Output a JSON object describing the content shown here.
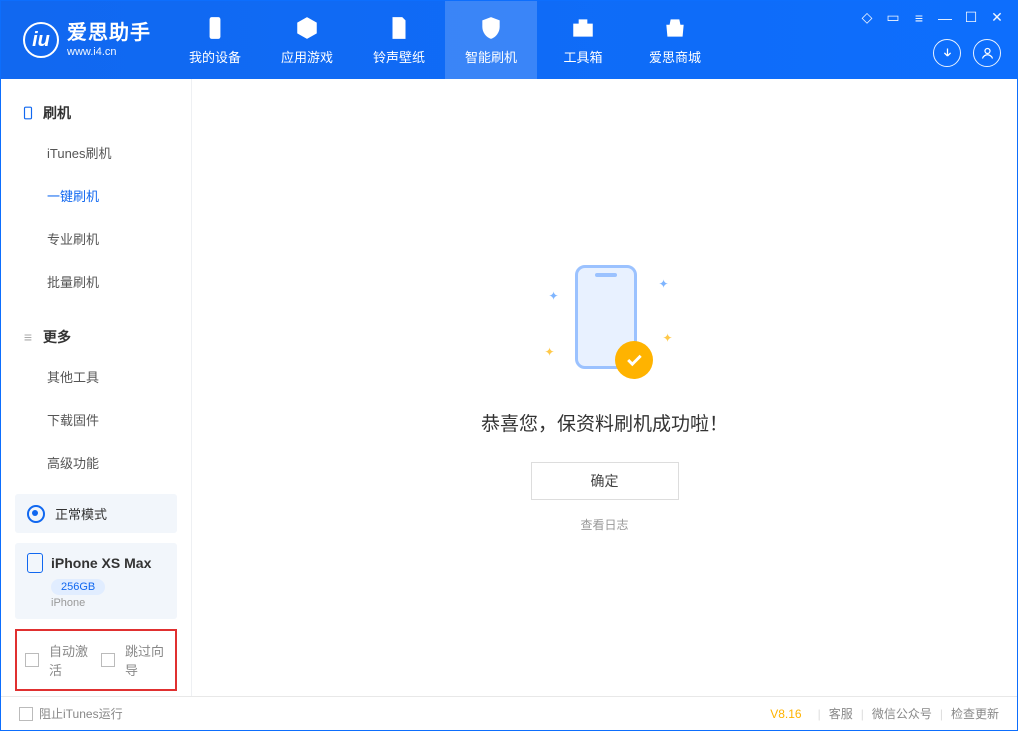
{
  "app": {
    "title": "爱思助手",
    "subtitle": "www.i4.cn",
    "logo_letter": "iu"
  },
  "nav": {
    "items": [
      {
        "label": "我的设备"
      },
      {
        "label": "应用游戏"
      },
      {
        "label": "铃声壁纸"
      },
      {
        "label": "智能刷机"
      },
      {
        "label": "工具箱"
      },
      {
        "label": "爱思商城"
      }
    ],
    "active_index": 3
  },
  "sidebar": {
    "section1": {
      "heading": "刷机",
      "items": [
        {
          "label": "iTunes刷机"
        },
        {
          "label": "一键刷机"
        },
        {
          "label": "专业刷机"
        },
        {
          "label": "批量刷机"
        }
      ],
      "active_index": 1
    },
    "section2": {
      "heading": "更多",
      "items": [
        {
          "label": "其他工具"
        },
        {
          "label": "下载固件"
        },
        {
          "label": "高级功能"
        }
      ]
    },
    "status": {
      "label": "正常模式"
    },
    "device": {
      "name": "iPhone XS Max",
      "capacity": "256GB",
      "type": "iPhone"
    },
    "options": {
      "auto_activate": "自动激活",
      "skip_guide": "跳过向导"
    }
  },
  "main": {
    "success_title": "恭喜您，保资料刷机成功啦！",
    "ok_button": "确定",
    "view_log": "查看日志"
  },
  "footer": {
    "block_itunes": "阻止iTunes运行",
    "version": "V8.16",
    "links": {
      "service": "客服",
      "wechat": "微信公众号",
      "update": "检查更新"
    }
  }
}
